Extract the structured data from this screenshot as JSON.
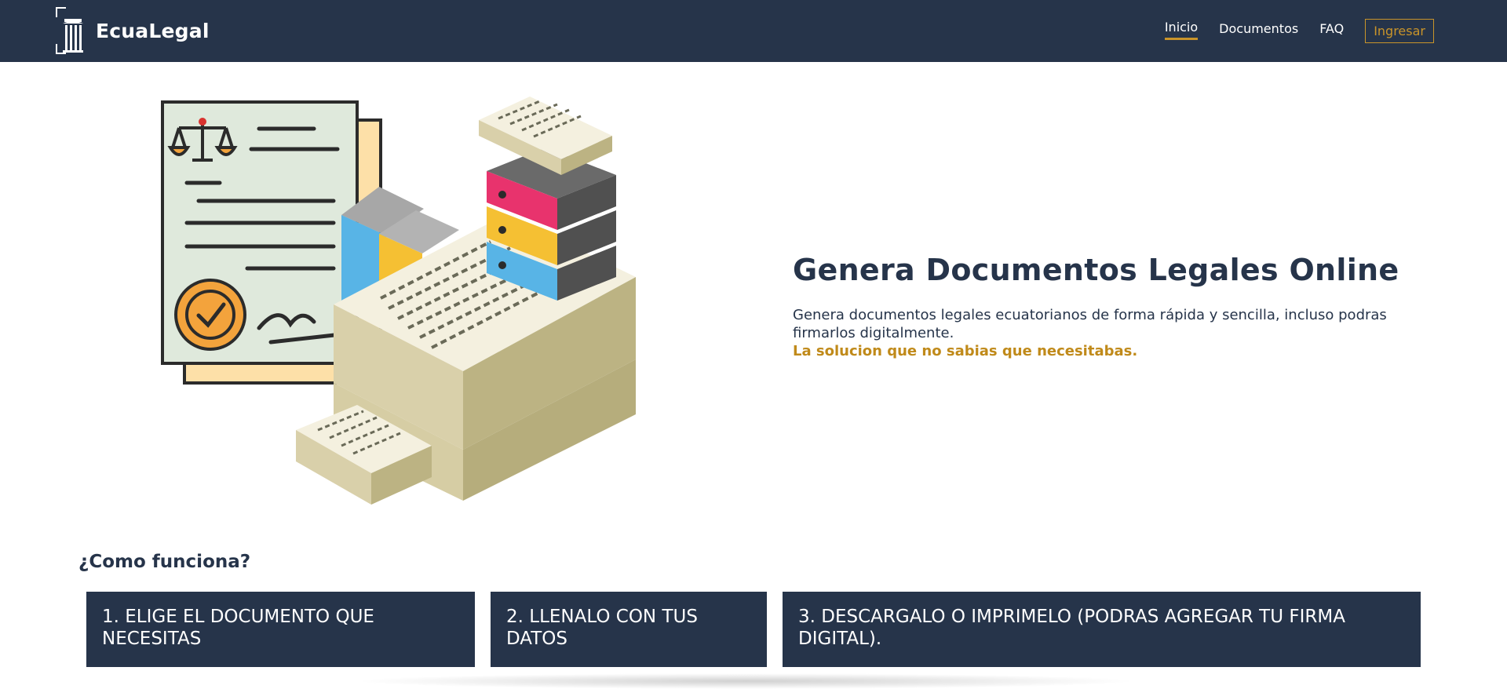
{
  "navbar": {
    "brand": "EcuaLegal",
    "links": [
      {
        "label": "Inicio",
        "active": true
      },
      {
        "label": "Documentos",
        "active": false
      },
      {
        "label": "FAQ",
        "active": false
      }
    ],
    "login_label": "Ingresar"
  },
  "hero": {
    "title": "Genera Documentos Legales Online",
    "description": "Genera documentos legales ecuatorianos de forma rápida y sencilla, incluso podras firmarlos digitalmente.",
    "tagline": "La solucion que no sabias que necesitabas."
  },
  "how_it_works": {
    "title": "¿Como funciona?",
    "steps": [
      "1. ELIGE EL DOCUMENTO QUE NECESITAS",
      "2. LLENALO CON TUS DATOS",
      "3. DESCARGALO O IMPRIMELO (PODRAS AGREGAR TU FIRMA DIGITAL)."
    ]
  },
  "colors": {
    "navbar": "#26344a",
    "accent": "#c9942a",
    "text": "#26344a"
  }
}
